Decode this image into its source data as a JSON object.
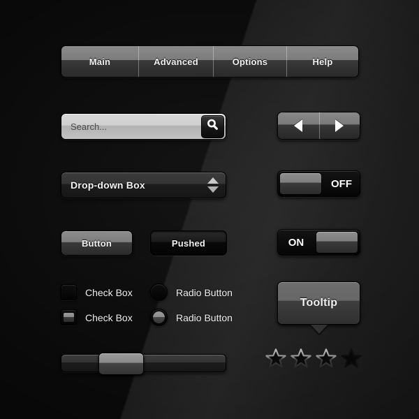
{
  "theme": {
    "background": "#0b0b0b",
    "accent_light": "#8a8a8a",
    "accent_dark": "#1a1a1a",
    "text_on_dark": "#f2f2f2",
    "text_on_light": "#3b3b3b"
  },
  "tabbar": {
    "name": "navigation-tabs",
    "tabs": [
      {
        "label": "Main",
        "selected": false
      },
      {
        "label": "Advanced",
        "selected": false
      },
      {
        "label": "Options",
        "selected": false
      },
      {
        "label": "Help",
        "selected": false
      }
    ]
  },
  "search": {
    "placeholder": "Search...",
    "value": "",
    "icon": "search-icon"
  },
  "arrow_nav": {
    "prev_icon": "triangle-left-icon",
    "next_icon": "triangle-right-icon"
  },
  "dropdown": {
    "label": "Drop-down Box",
    "up_icon": "triangle-up-icon",
    "down_icon": "triangle-down-icon"
  },
  "toggles": [
    {
      "name": "toggle-off",
      "label": "OFF",
      "state": "off",
      "knob_side": "left"
    },
    {
      "name": "toggle-on",
      "label": "ON",
      "state": "on",
      "knob_side": "right"
    }
  ],
  "buttons": [
    {
      "name": "button-normal",
      "label": "Button",
      "state": "normal"
    },
    {
      "name": "button-pushed",
      "label": "Pushed",
      "state": "pushed"
    }
  ],
  "checkboxes": [
    {
      "label": "Check Box",
      "checked": false
    },
    {
      "label": "Check Box",
      "checked": true
    }
  ],
  "radios": [
    {
      "label": "Radio Button",
      "selected": false
    },
    {
      "label": "Radio Button",
      "selected": true
    }
  ],
  "tooltip": {
    "label": "Tooltip",
    "tail": "pointer-down"
  },
  "slider": {
    "name": "range-slider",
    "value_percent": 31,
    "min": 0,
    "max": 100
  },
  "rating": {
    "name": "star-rating",
    "total": 4,
    "filled": 1,
    "stars": [
      {
        "state": "outline"
      },
      {
        "state": "outline"
      },
      {
        "state": "outline"
      },
      {
        "state": "filled"
      }
    ]
  }
}
